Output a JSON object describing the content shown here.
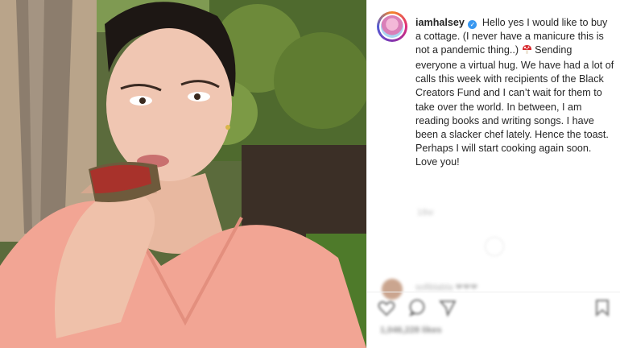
{
  "post": {
    "username": "iamhalsey",
    "verified_icon": "verified-badge-icon",
    "caption_before_emoji": "Hello yes I would like to buy a cottage. (I never have a manicure this is not a pandemic thing..)",
    "emoji_icon": "mushroom-icon",
    "caption_after_emoji": "Sending everyone a virtual hug. We have had a lot of calls this week with recipients of the Black Creators Fund and I can’t wait for them to take over the world. In between, I am reading books and writing songs. I have been a slacker chef lately. Hence the toast. Perhaps I will start cooking again soon. Love you!",
    "age": "18w",
    "likes": "1,046,228 likes"
  },
  "comment_preview": {
    "text": "sofiblabla ❤❤❤"
  },
  "actions": {
    "like_icon": "heart-icon",
    "comment_icon": "comment-icon",
    "share_icon": "send-icon",
    "save_icon": "bookmark-icon"
  },
  "colors": {
    "verified": "#3897f0",
    "dress": "#f2a594",
    "text": "#262626",
    "muted": "#8e8e8e"
  }
}
